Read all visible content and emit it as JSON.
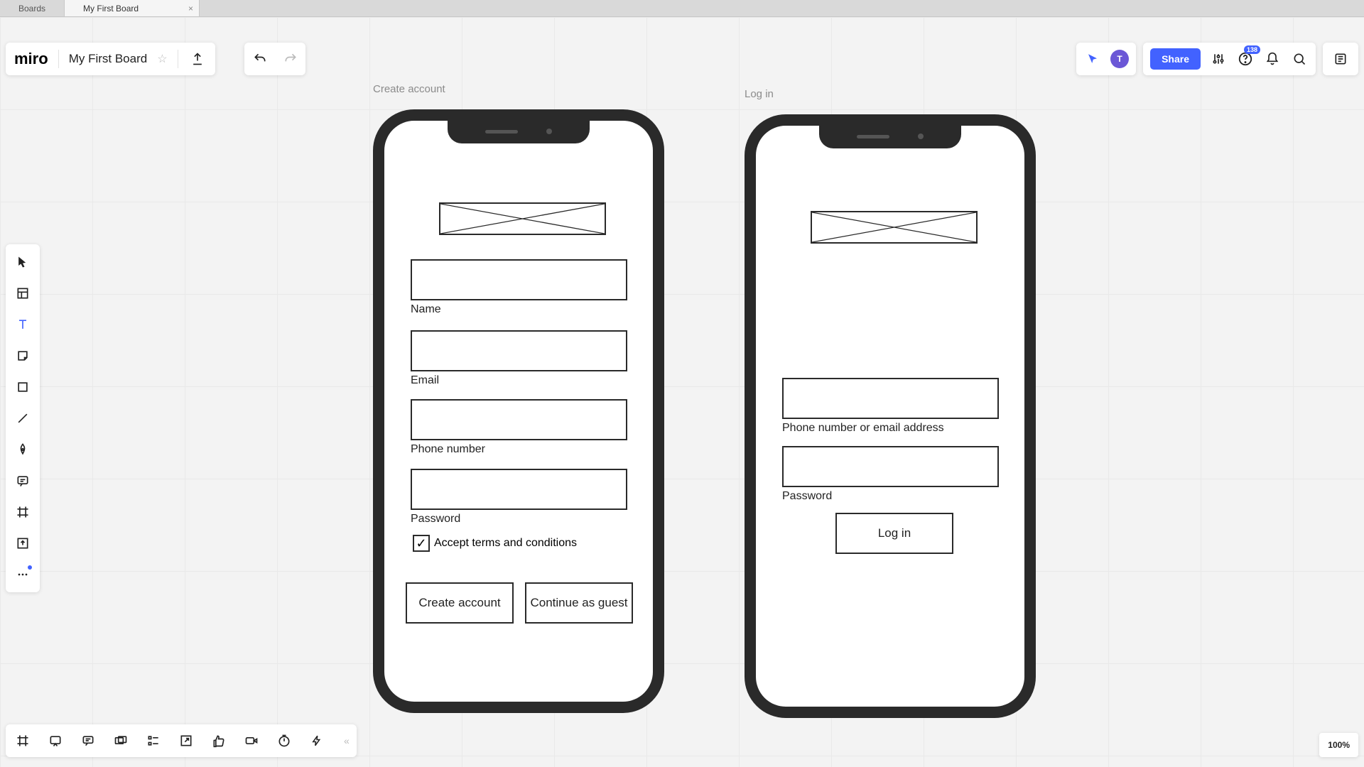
{
  "tabs": {
    "boards": "Boards",
    "active": "My First Board"
  },
  "header": {
    "logo": "miro",
    "board_name": "My First Board",
    "share": "Share",
    "help_badge": "138",
    "avatar_initial": "T"
  },
  "zoom": "100%",
  "frames": {
    "create": {
      "title": "Create account",
      "fields": {
        "name": "Name",
        "email": "Email",
        "phone": "Phone number",
        "password": "Password"
      },
      "checkbox": "Accept terms and conditions",
      "buttons": {
        "create": "Create account",
        "guest": "Continue as guest"
      }
    },
    "login": {
      "title": "Log in",
      "fields": {
        "identifier": "Phone number or email address",
        "password": "Password"
      },
      "button": "Log in"
    }
  }
}
